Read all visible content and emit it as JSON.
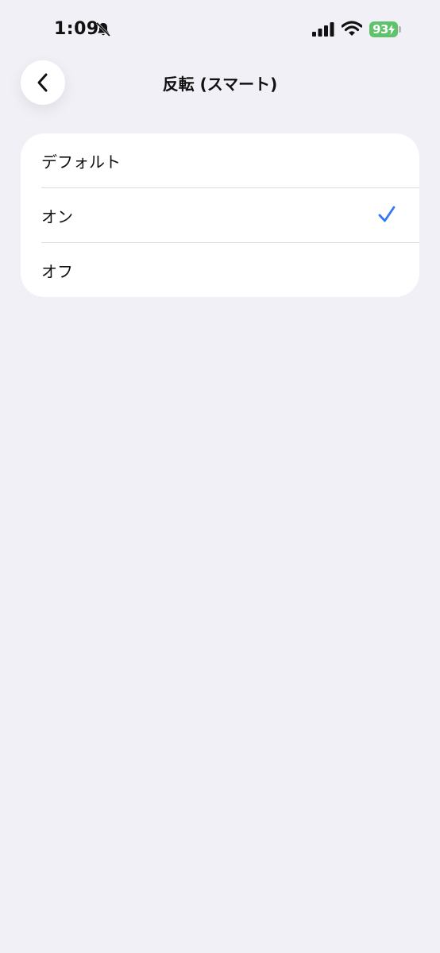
{
  "status_bar": {
    "time": "1:09",
    "battery_level": "93",
    "icons": [
      "bell-slash-icon",
      "cellular-signal-icon",
      "wifi-icon",
      "battery-charging-icon"
    ]
  },
  "header": {
    "title": "反転 (スマート)",
    "back_icon": "chevron-left-icon"
  },
  "options": [
    {
      "label": "デフォルト",
      "selected": false
    },
    {
      "label": "オン",
      "selected": true
    },
    {
      "label": "オフ",
      "selected": false
    }
  ],
  "colors": {
    "background": "#f1f0f6",
    "card": "#ffffff",
    "accent": "#3478f6",
    "battery": "#5ec36b"
  }
}
